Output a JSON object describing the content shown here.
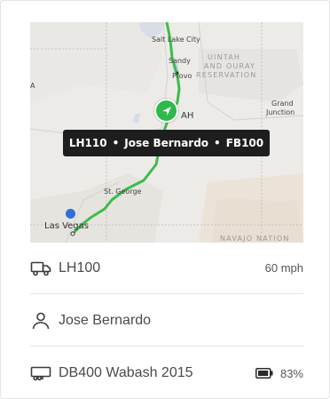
{
  "map": {
    "labels": {
      "salt_lake_city": "Salt Lake City",
      "sandy": "Sandy",
      "provo": "Provo",
      "uintah_line1": "UINTAH",
      "uintah_line2": "AND OURAY",
      "uintah_line3": "RESERVATION",
      "utah": "AH",
      "grand_junction_line1": "Grand",
      "grand_junction_line2": "Junction",
      "st_george": "St. George",
      "las_vegas": "Las Vegas",
      "navajo_nation": "NAVAJO NATION",
      "left_edge": "A"
    },
    "route_color": "#3dbb4d",
    "marker_color": "#2fb94b",
    "dot_color": "#2f6fd6"
  },
  "tooltip": {
    "vehicle": "LH110",
    "driver": "Jose Bernardo",
    "trailer": "FB100",
    "separator": "•"
  },
  "vehicle": {
    "name": "LH100",
    "speed": "60 mph"
  },
  "driver": {
    "name": "Jose Bernardo"
  },
  "trailer": {
    "name": "DB400 Wabash 2015",
    "battery": "83%",
    "battery_level": 0.83
  }
}
